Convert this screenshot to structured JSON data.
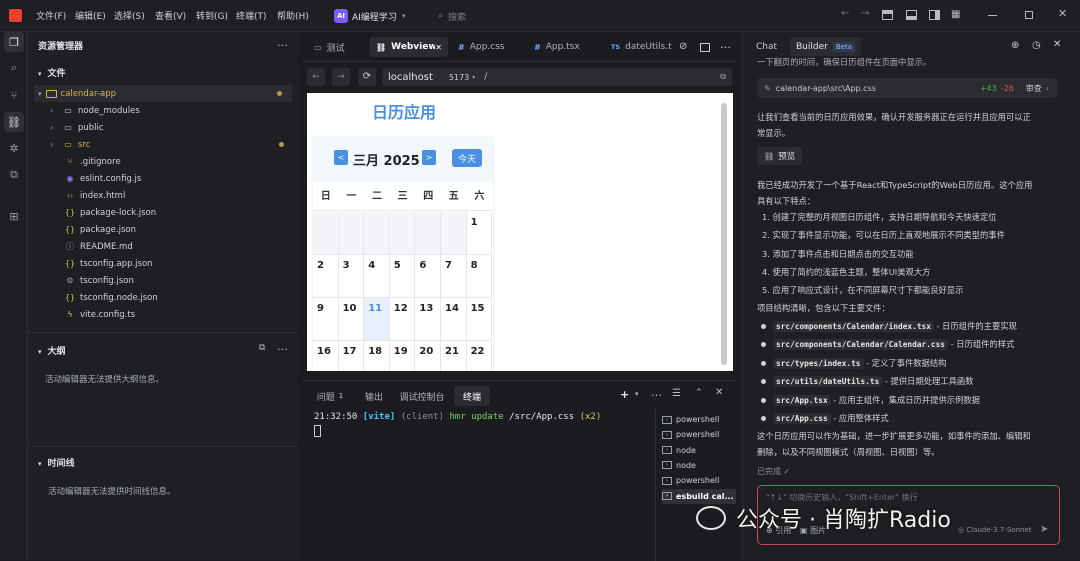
{
  "title_bar": {
    "menu": [
      "文件(F)",
      "编辑(E)",
      "选择(S)",
      "查看(V)",
      "转到(G)",
      "终端(T)",
      "帮助(H)"
    ],
    "workspace_badge": "AI",
    "workspace": "AI编程学习",
    "search_placeholder": "搜索"
  },
  "explorer": {
    "header": "资源管理器",
    "section": "文件",
    "root": "calendar-app",
    "items": [
      {
        "name": "node_modules",
        "icon": "folder-icon",
        "kind": "folder"
      },
      {
        "name": "public",
        "icon": "folder-icon",
        "kind": "folder"
      },
      {
        "name": "src",
        "icon": "folder-icon",
        "kind": "folder-modified"
      },
      {
        "name": ".gitignore",
        "icon": "git-icon",
        "kind": "file"
      },
      {
        "name": "eslint.config.js",
        "icon": "eslint-icon",
        "kind": "file"
      },
      {
        "name": "index.html",
        "icon": "html-icon",
        "kind": "file"
      },
      {
        "name": "package-lock.json",
        "icon": "json-icon",
        "kind": "file"
      },
      {
        "name": "package.json",
        "icon": "json-icon",
        "kind": "file"
      },
      {
        "name": "README.md",
        "icon": "info-icon",
        "kind": "file"
      },
      {
        "name": "tsconfig.app.json",
        "icon": "json-icon",
        "kind": "file"
      },
      {
        "name": "tsconfig.json",
        "icon": "gear-icon",
        "kind": "file"
      },
      {
        "name": "tsconfig.node.json",
        "icon": "json-icon",
        "kind": "file"
      },
      {
        "name": "vite.config.ts",
        "icon": "vite-icon",
        "kind": "file"
      }
    ],
    "outline_header": "大纲",
    "outline_empty": "活动编辑器无法提供大纲信息。",
    "timeline_header": "时间线",
    "timeline_empty": "活动编辑器无法提供时间线信息。"
  },
  "editor": {
    "tabs": [
      {
        "label": "测试",
        "icon": "file-icon"
      },
      {
        "label": "Webview",
        "icon": "link-icon",
        "active": true
      },
      {
        "label": "App.css",
        "icon": "css-icon"
      },
      {
        "label": "App.tsx",
        "icon": "tsx-icon"
      },
      {
        "label": "dateUtils.t",
        "icon": "ts-icon",
        "prefix": "TS"
      }
    ],
    "url_host": "localhost",
    "url_port": "5173",
    "url_path": "/"
  },
  "calendar": {
    "heading": "日历应用",
    "month": "三月 2025",
    "prev": "<",
    "next": ">",
    "today": "今天",
    "weekdays": [
      "日",
      "一",
      "二",
      "三",
      "四",
      "五",
      "六"
    ],
    "rows": [
      [
        "",
        "",
        "",
        "",
        "",
        "",
        "1"
      ],
      [
        "2",
        "3",
        "4",
        "5",
        "6",
        "7",
        "8"
      ],
      [
        "9",
        "10",
        "11",
        "12",
        "13",
        "14",
        "15"
      ],
      [
        "16",
        "17",
        "18",
        "19",
        "20",
        "21",
        "22"
      ]
    ],
    "highlight": "11"
  },
  "panel": {
    "tabs": [
      "问题",
      "输出",
      "调试控制台",
      "终端"
    ],
    "problems_count": "1",
    "active": "终端",
    "terminal_time": "21:32:50",
    "terminal_tag": "[vite]",
    "terminal_client": "(client)",
    "terminal_msg": "hmr update",
    "terminal_path": "/src/App.css",
    "terminal_count": "(x2)",
    "terminals": [
      "powershell",
      "powershell",
      "node",
      "node",
      "powershell",
      "esbuild cal..."
    ]
  },
  "chat": {
    "tabs": [
      "Chat",
      "Builder"
    ],
    "beta": "Beta",
    "top_text": "一下翻页的时间，确保日历组件在页面中显示。",
    "file_change": "calendar-app\\src\\App.css",
    "added": "+43",
    "removed": "-26",
    "review": "审查",
    "para1": [
      "让我们查看当前的日历应用效果，确认开发服务器正在运行并且应用可以正",
      "常显示。"
    ],
    "preview": "预览",
    "para2": [
      "我已经成功开发了一个基于React和TypeScript的Web日历应用。这个应用",
      "具有以下特点："
    ],
    "features": [
      "1. 创建了完整的月视图日历组件，支持日期导航和今天快速定位",
      "2. 实现了事件显示功能，可以在日历上直观地展示不同类型的事件",
      "3. 添加了事件点击和日期点击的交互功能",
      "4. 使用了简约的浅蓝色主题，整体UI美观大方",
      "5. 应用了响应式设计，在不同屏幕尺寸下都能良好显示"
    ],
    "structure_intro": "项目结构清晰，包含以下主要文件：",
    "files": [
      {
        "path": "src/components/Calendar/index.tsx",
        "desc": " - 日历组件的主要实现"
      },
      {
        "path": "src/components/Calendar/Calendar.css",
        "desc": " - 日历组件的样式"
      },
      {
        "path": "src/types/index.ts",
        "desc": " - 定义了事件数据结构"
      },
      {
        "path": "src/utils/dateUtils.ts",
        "desc": " - 提供日期处理工具函数"
      },
      {
        "path": "src/App.tsx",
        "desc": " - 应用主组件，集成日历并提供示例数据"
      },
      {
        "path": "src/App.css",
        "desc": " - 应用整体样式"
      }
    ],
    "para3": [
      "这个日历应用可以作为基础，进一步扩展更多功能，如事件的添加、编辑和",
      "删除，以及不同视图模式（周视图、日视图）等。"
    ],
    "done": "已完成",
    "input_placeholder": "\"↑↓\" 切换历史输入，\"Shift+Enter\" 换行",
    "quote": "引用",
    "image": "图片",
    "model": "Claude-3.7-Sonnet"
  },
  "watermark": "公众号 · 肖陶扩Radio",
  "colors": {
    "accent": "#4a90e2",
    "calendar_heading": "#4a90e2",
    "highlight_bg": "#e8f1fb",
    "added": "#4caf50",
    "removed": "#e05252",
    "terminal_tag": "#4fc3f7",
    "terminal_client": "#8a8f95",
    "terminal_msg": "#7ccf6b",
    "terminal_count": "#e5c07b"
  }
}
